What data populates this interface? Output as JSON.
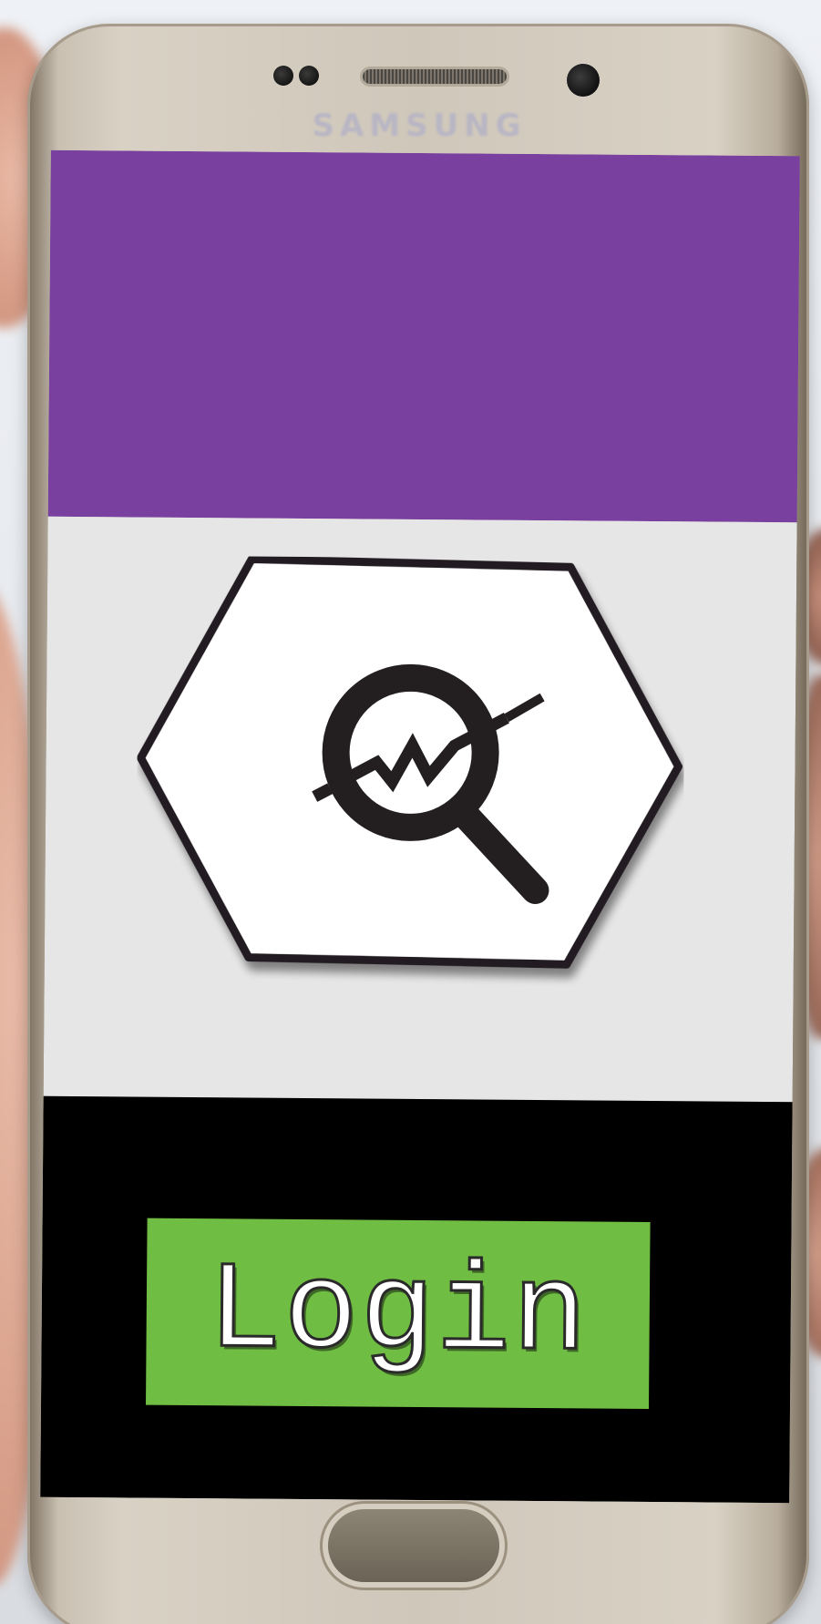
{
  "device": {
    "brand_text": "SAMSUNG"
  },
  "app": {
    "colors": {
      "header": "#7a40a0",
      "content_background": "#e6e6e6",
      "footer": "#000000",
      "login_button": "#70bd44",
      "logo_stroke": "#231f20"
    },
    "logo": {
      "icon": "analytics-magnifier-icon"
    },
    "login": {
      "label": "Login"
    }
  }
}
